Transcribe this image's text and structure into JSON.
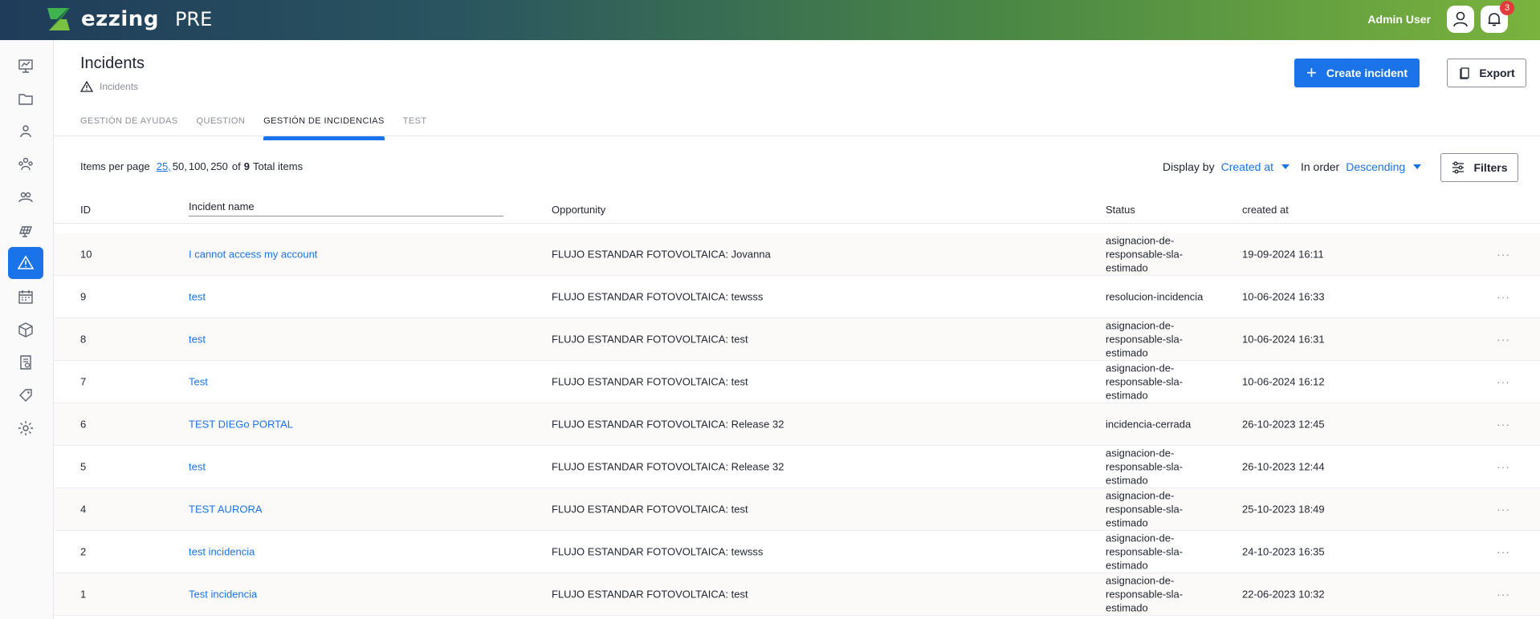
{
  "app": {
    "logo_text": "ezzing",
    "environment": "PRE"
  },
  "user": {
    "name": "Admin User",
    "notification_count": "3"
  },
  "sidebar": {
    "items": [
      {
        "icon": "dashboard-icon"
      },
      {
        "icon": "folder-icon"
      },
      {
        "icon": "users-icon"
      },
      {
        "icon": "team-icon"
      },
      {
        "icon": "group-icon"
      },
      {
        "icon": "solar-panel-icon"
      },
      {
        "icon": "warning-icon",
        "active": true
      },
      {
        "icon": "calendar-icon"
      },
      {
        "icon": "box-icon"
      },
      {
        "icon": "invoice-icon"
      },
      {
        "icon": "tag-icon"
      },
      {
        "icon": "settings-icon"
      }
    ]
  },
  "header": {
    "title": "Incidents",
    "breadcrumb": "Incidents",
    "create_label": "Create incident",
    "export_label": "Export"
  },
  "tabs": [
    {
      "label": "GESTIÓN DE AYUDAS"
    },
    {
      "label": "QUESTION"
    },
    {
      "label": "GESTIÓN DE INCIDENCIAS",
      "active": true
    },
    {
      "label": "TEST"
    }
  ],
  "pagination": {
    "label": "Items per page",
    "current": "25,",
    "options": [
      "50,",
      "100,",
      "250"
    ],
    "of": "of",
    "total": "9",
    "total_suffix": "Total items"
  },
  "sort": {
    "display_label": "Display by",
    "display_value": "Created at",
    "order_label": "In order",
    "order_value": "Descending",
    "filters_label": "Filters"
  },
  "table": {
    "headers": {
      "id": "ID",
      "name": "Incident name",
      "opportunity": "Opportunity",
      "status": "Status",
      "created": "created at"
    },
    "rows": [
      {
        "id": "10",
        "name": "I cannot access my account",
        "opportunity": "FLUJO ESTANDAR FOTOVOLTAICA: Jovanna",
        "status": "asignacion-de-responsable-sla-estimado",
        "created": "19-09-2024 16:11"
      },
      {
        "id": "9",
        "name": "test",
        "opportunity": "FLUJO ESTANDAR FOTOVOLTAICA: tewsss",
        "status": "resolucion-incidencia",
        "created": "10-06-2024 16:33"
      },
      {
        "id": "8",
        "name": "test",
        "opportunity": "FLUJO ESTANDAR FOTOVOLTAICA: test",
        "status": "asignacion-de-responsable-sla-estimado",
        "created": "10-06-2024 16:31"
      },
      {
        "id": "7",
        "name": "Test",
        "opportunity": "FLUJO ESTANDAR FOTOVOLTAICA: test",
        "status": "asignacion-de-responsable-sla-estimado",
        "created": "10-06-2024 16:12"
      },
      {
        "id": "6",
        "name": "TEST DIEGo PORTAL",
        "opportunity": "FLUJO ESTANDAR FOTOVOLTAICA: Release 32",
        "status": "incidencia-cerrada",
        "created": "26-10-2023 12:45"
      },
      {
        "id": "5",
        "name": "test",
        "opportunity": "FLUJO ESTANDAR FOTOVOLTAICA: Release 32",
        "status": "asignacion-de-responsable-sla-estimado",
        "created": "26-10-2023 12:44"
      },
      {
        "id": "4",
        "name": "TEST AURORA",
        "opportunity": "FLUJO ESTANDAR FOTOVOLTAICA: test",
        "status": "asignacion-de-responsable-sla-estimado",
        "created": "25-10-2023 18:49"
      },
      {
        "id": "2",
        "name": "test incidencia",
        "opportunity": "FLUJO ESTANDAR FOTOVOLTAICA: tewsss",
        "status": "asignacion-de-responsable-sla-estimado",
        "created": "24-10-2023 16:35"
      },
      {
        "id": "1",
        "name": "Test incidencia",
        "opportunity": "FLUJO ESTANDAR FOTOVOLTAICA: test",
        "status": "asignacion-de-responsable-sla-estimado",
        "created": "22-06-2023 10:32"
      }
    ],
    "row_action": "···"
  },
  "colors": {
    "accent": "#1a73e8",
    "badge": "#e23b3b"
  }
}
